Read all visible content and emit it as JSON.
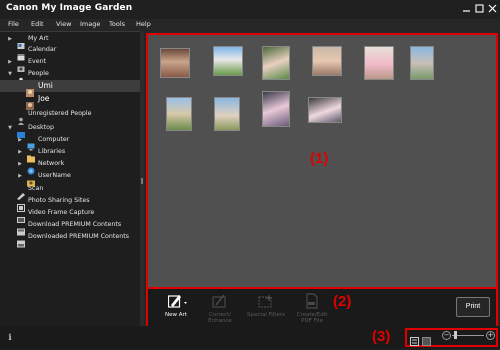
{
  "window": {
    "title": "Canon My Image Garden"
  },
  "menu": [
    "File",
    "Edit",
    "View",
    "Image",
    "Tools",
    "Help"
  ],
  "sidebar": {
    "items": [
      {
        "label": "My Art",
        "arrow": "▶",
        "icon": "my-art-icon"
      },
      {
        "label": "Calendar",
        "arrow": "",
        "icon": "calendar-icon"
      },
      {
        "label": "Event",
        "arrow": "▶",
        "icon": "event-icon"
      },
      {
        "label": "People",
        "arrow": "▼",
        "icon": "people-icon"
      },
      {
        "label": "Umi",
        "arrow": "",
        "icon": "person-photo-icon"
      },
      {
        "label": "Joe",
        "arrow": "",
        "icon": "person-photo-icon"
      },
      {
        "label": "Unregistered People",
        "arrow": "",
        "icon": "unregistered-people-icon"
      },
      {
        "label": "Desktop",
        "arrow": "▼",
        "icon": "desktop-icon"
      },
      {
        "label": "Computer",
        "arrow": "▶",
        "icon": "computer-icon"
      },
      {
        "label": "Libraries",
        "arrow": "▶",
        "icon": "libraries-icon"
      },
      {
        "label": "Network",
        "arrow": "▶",
        "icon": "network-icon"
      },
      {
        "label": "UserName",
        "arrow": "▶",
        "icon": "user-folder-icon"
      },
      {
        "label": "Scan",
        "arrow": "",
        "icon": "scan-icon"
      },
      {
        "label": "Photo Sharing Sites",
        "arrow": "",
        "icon": "photo-sharing-icon"
      },
      {
        "label": "Video Frame Capture",
        "arrow": "",
        "icon": "video-frame-icon"
      },
      {
        "label": "Download PREMIUM Contents",
        "arrow": "",
        "icon": "download-icon"
      },
      {
        "label": "Downloaded PREMIUM Contents",
        "arrow": "",
        "icon": "downloaded-icon"
      }
    ]
  },
  "callouts": {
    "area1": "(1)",
    "area2": "(2)",
    "area3": "(3)"
  },
  "toolbar": {
    "new_art": "New Art",
    "correct_enhance": "Correct/ Enhance",
    "special_filters": "Special Filters",
    "create_edit_pdf": "Create/Edit PDF File",
    "print": "Print"
  },
  "thumbnail_count": 10,
  "colors": {
    "accent_red": "#e00000",
    "grid_bg": "#505050"
  }
}
